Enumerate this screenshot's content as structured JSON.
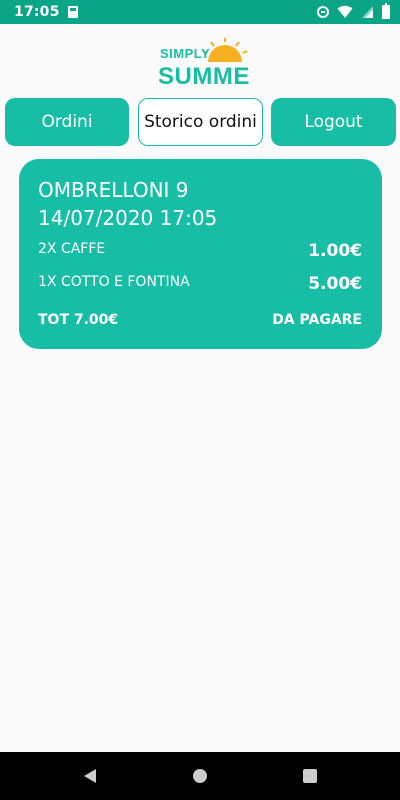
{
  "status_bar": {
    "time": "17:05",
    "icons": [
      "sd-card-icon",
      "do-not-disturb-icon",
      "wifi-icon",
      "signal-icon",
      "battery-icon"
    ]
  },
  "logo": {
    "line1": "SIMPLY",
    "line2": "SUMMER",
    "colors": {
      "text": "#17bea5",
      "sun": "#f5b021"
    }
  },
  "tabs": [
    {
      "label": "Ordini",
      "active": false
    },
    {
      "label": "Storico ordini",
      "active": true
    },
    {
      "label": "Logout",
      "active": false
    }
  ],
  "order": {
    "location": "OMBRELLONI 9",
    "datetime": "14/07/2020 17:05",
    "items": [
      {
        "description": "2X  CAFFE",
        "price": "1.00€"
      },
      {
        "description": "1X  COTTO E FONTINA",
        "price": "5.00€"
      }
    ],
    "total": "TOT 7.00€",
    "status": "DA PAGARE"
  },
  "nav_bar": {
    "buttons": [
      "back-icon",
      "home-icon",
      "recents-icon"
    ]
  },
  "colors": {
    "primary": "#17bea5",
    "status_bar": "#0aa586",
    "background": "#fafafa"
  }
}
